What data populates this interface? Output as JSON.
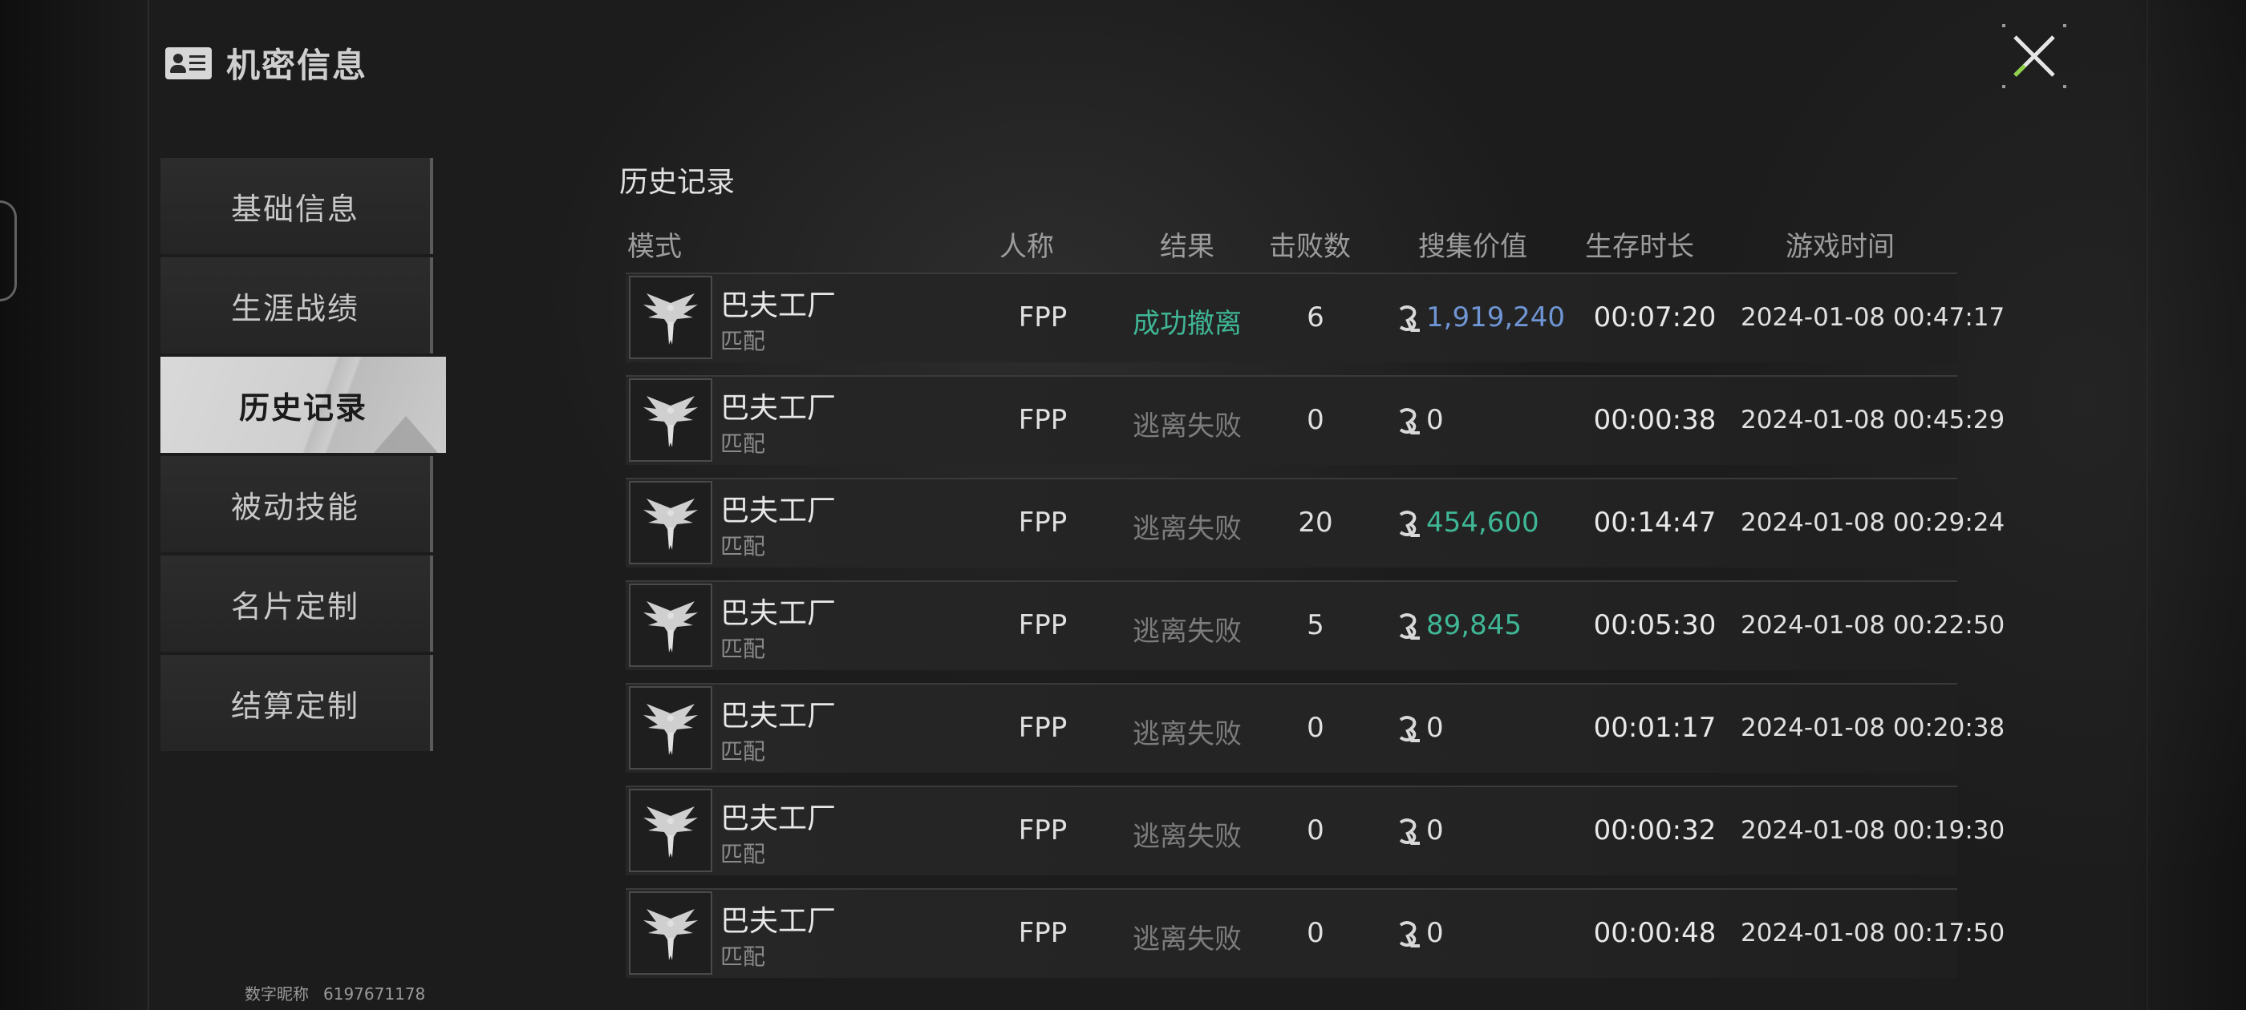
{
  "header": {
    "title": "机密信息",
    "icon": "id-card-icon"
  },
  "close": {
    "icon": "close-x-icon",
    "accent": "#8fd34a"
  },
  "sidebar": {
    "items": [
      {
        "label": "基础信息"
      },
      {
        "label": "生涯战绩"
      },
      {
        "label": "历史记录",
        "active": true
      },
      {
        "label": "被动技能"
      },
      {
        "label": "名片定制"
      },
      {
        "label": "结算定制"
      }
    ]
  },
  "footer": {
    "nickname_label": "数字昵称",
    "nickname_value": "6197671178"
  },
  "history": {
    "title": "历史记录",
    "columns": {
      "mode": "模式",
      "perspective": "人称",
      "result": "结果",
      "kills": "击败数",
      "value": "搜集价值",
      "survival": "生存时长",
      "game_time": "游戏时间"
    },
    "rows": [
      {
        "map": "巴夫工厂",
        "mode": "匹配",
        "perspective": "FPP",
        "result": "成功撤离",
        "kills": "6",
        "value": "1,919,240",
        "survival": "00:07:20",
        "game_time": "2024-01-08 00:47:17"
      },
      {
        "map": "巴夫工厂",
        "mode": "匹配",
        "perspective": "FPP",
        "result": "逃离失败",
        "kills": "0",
        "value": "0",
        "survival": "00:00:38",
        "game_time": "2024-01-08 00:45:29"
      },
      {
        "map": "巴夫工厂",
        "mode": "匹配",
        "perspective": "FPP",
        "result": "逃离失败",
        "kills": "20",
        "value": "454,600",
        "survival": "00:14:47",
        "game_time": "2024-01-08 00:29:24"
      },
      {
        "map": "巴夫工厂",
        "mode": "匹配",
        "perspective": "FPP",
        "result": "逃离失败",
        "kills": "5",
        "value": "89,845",
        "survival": "00:05:30",
        "game_time": "2024-01-08 00:22:50"
      },
      {
        "map": "巴夫工厂",
        "mode": "匹配",
        "perspective": "FPP",
        "result": "逃离失败",
        "kills": "0",
        "value": "0",
        "survival": "00:01:17",
        "game_time": "2024-01-08 00:20:38"
      },
      {
        "map": "巴夫工厂",
        "mode": "匹配",
        "perspective": "FPP",
        "result": "逃离失败",
        "kills": "0",
        "value": "0",
        "survival": "00:00:32",
        "game_time": "2024-01-08 00:19:30"
      },
      {
        "map": "巴夫工厂",
        "mode": "匹配",
        "perspective": "FPP",
        "result": "逃离失败",
        "kills": "0",
        "value": "0",
        "survival": "00:00:48",
        "game_time": "2024-01-08 00:17:50"
      }
    ]
  },
  "colors": {
    "success": "#3fb796",
    "fail": "#7c7c7c",
    "value_blue": "#6f95d4",
    "value_green": "#3fb796"
  }
}
